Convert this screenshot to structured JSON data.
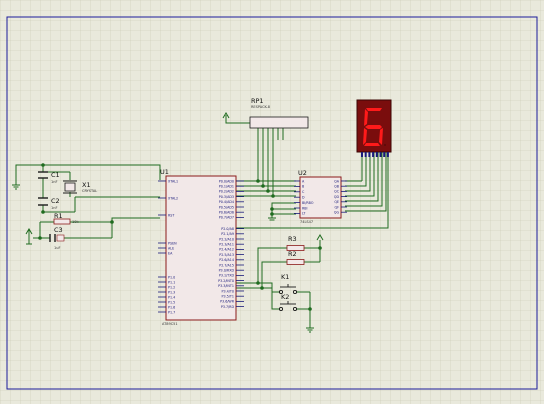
{
  "components": {
    "u1": {
      "ref": "U1",
      "part": "AT89C51",
      "pins_left": [
        "XTAL1",
        "XTAL2",
        "RST",
        "PSEN",
        "ALE",
        "EA",
        "P1.0",
        "P1.1",
        "P1.2",
        "P1.3",
        "P1.4",
        "P1.5",
        "P1.6",
        "P1.7"
      ],
      "pins_right": [
        "P0.0/AD0",
        "P0.1/AD1",
        "P0.2/AD2",
        "P0.3/AD3",
        "P0.4/AD4",
        "P0.5/AD5",
        "P0.6/AD6",
        "P0.7/AD7",
        "P2.0/A8",
        "P2.1/A9",
        "P2.2/A10",
        "P2.3/A11",
        "P2.4/A12",
        "P2.5/A13",
        "P2.6/A14",
        "P2.7/A15",
        "P3.0/RXD",
        "P3.1/TXD",
        "P3.2/INT0",
        "P3.3/INT1",
        "P3.4/T0",
        "P3.5/T1",
        "P3.6/WR",
        "P3.7/RD"
      ]
    },
    "u2": {
      "ref": "U2",
      "part": "74LS47",
      "pins_left": [
        "A",
        "B",
        "C",
        "D",
        "BI/RBO",
        "RBI",
        "LT"
      ],
      "pins_right": [
        "QA",
        "QB",
        "QC",
        "QD",
        "QE",
        "QF",
        "QG"
      ]
    },
    "rp1": {
      "ref": "RP1",
      "part": "RESPACK-8"
    },
    "x1": {
      "ref": "X1",
      "part": "CRYSTAL"
    },
    "c1": {
      "ref": "C1",
      "value": "1nF"
    },
    "c2": {
      "ref": "C2",
      "value": "1nF"
    },
    "c3": {
      "ref": "C3",
      "value": "1uF"
    },
    "r1": {
      "ref": "R1",
      "value": "10k"
    },
    "r2": {
      "ref": "R2",
      "value": ""
    },
    "r3": {
      "ref": "R3",
      "value": ""
    },
    "k1": {
      "ref": "K1"
    },
    "k2": {
      "ref": "K2"
    },
    "display": {
      "digit": "6"
    }
  },
  "colors": {
    "wire": "#1f6b1f",
    "body": "#f2e8e8",
    "body_border": "#8b1a1a",
    "pin": "#1a1a7a",
    "display_on": "#ff1a1a",
    "display_bg": "#7a0d0d",
    "frame": "#1a1a9a"
  }
}
